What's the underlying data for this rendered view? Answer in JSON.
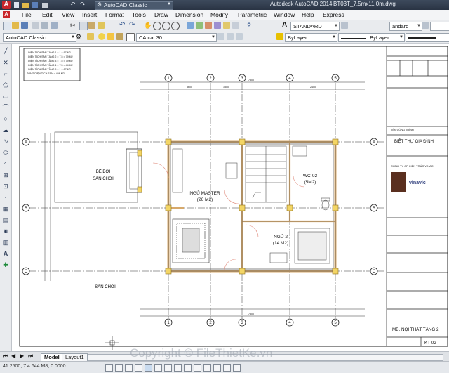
{
  "window": {
    "quick_access_title": "AutoCAD Classic",
    "app_title": "Autodesk AutoCAD 2014",
    "file_name": "BT03T_7.5mx11.0m.dwg",
    "watermark_logo": "File Thiết Kế .vn"
  },
  "menu": [
    "File",
    "Edit",
    "View",
    "Insert",
    "Format",
    "Tools",
    "Draw",
    "Dimension",
    "Modify",
    "Parametric",
    "Window",
    "Help",
    "Express"
  ],
  "toolbar": {
    "workspace": "AutoCAD Classic",
    "text_style": "STANDARD",
    "dim_style": "andard",
    "layer": "CA.cat 30",
    "color": "ByLayer",
    "linetype": "ByLayer"
  },
  "drawing": {
    "area_notes": [
      "- DIỆN TÍCH SÀN TẦNG 1 = 1   = 97 M2",
      "- DIỆN TÍCH SÀN TẦNG 2 = 7.5 = 79 M2",
      "- DIỆN TÍCH SÀN TẦNG 3 = 7.5 = 79 M2",
      "- DIỆN TÍCH SÀN TẦNG 4 = 7.5 = 44 M2",
      "- DIỆN TÍCH SÀN TẦNG 5 = 1   = 67 M2",
      "  TỔNG DIỆN TÍCH SÀN   = 456 M2"
    ],
    "grid_numbers": [
      "1",
      "2",
      "3",
      "4",
      "5"
    ],
    "grid_letters": [
      "A",
      "B",
      "C"
    ],
    "dim_total": "7500",
    "dim_segments": [
      "3600",
      "1500",
      "2400"
    ],
    "rooms": [
      {
        "name": "NGỦ MASTER",
        "area": "(26 M2)"
      },
      {
        "name": "WC-02",
        "area": "(5M2)"
      },
      {
        "name": "NGỦ 2",
        "area": "(14 M2)"
      }
    ],
    "outdoor_labels": [
      "BỂ BƠI",
      "SÂN CHƠI",
      "SÂN CHƠI"
    ]
  },
  "title_block": {
    "project_label": "TÊN CÔNG TRÌNH",
    "project_name": "BIỆT THỰ GIA ĐÌNH",
    "company": "CÔNG TY CP KIẾN TRÚC VINAC",
    "logo_text": "vinavic",
    "sheet_title": "MB. NỘI THẤT TẦNG 2",
    "sheet_number": "KT-02"
  },
  "tabs": [
    "Model",
    "Layout1"
  ],
  "status": {
    "coords": "41.2500, 7.4.644 M8, 0.0000"
  }
}
